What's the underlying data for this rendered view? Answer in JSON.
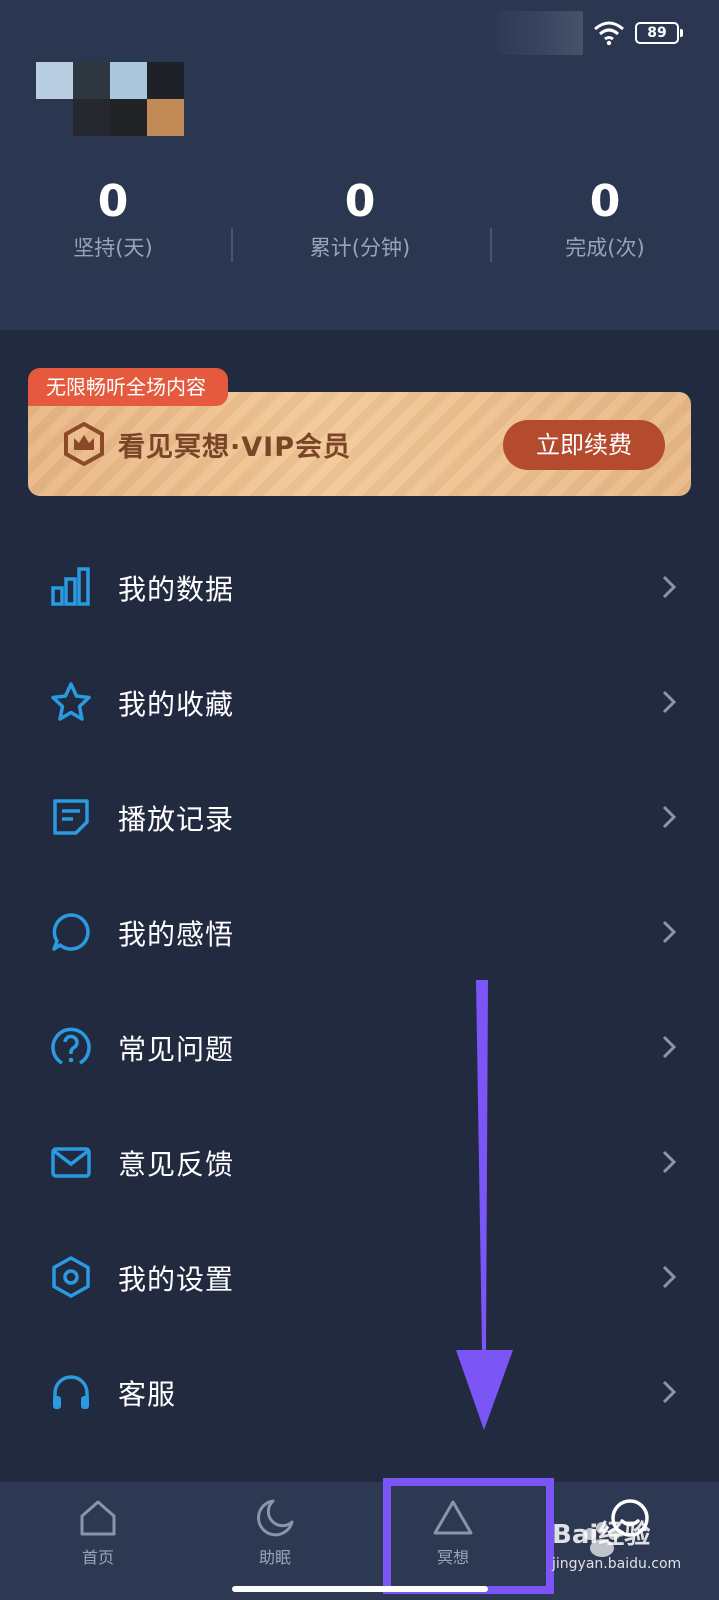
{
  "status": {
    "battery": "89"
  },
  "stats": [
    {
      "value": "0",
      "label": "坚持(天)"
    },
    {
      "value": "0",
      "label": "累计(分钟)"
    },
    {
      "value": "0",
      "label": "完成(次)"
    }
  ],
  "vip": {
    "tag": "无限畅听全场内容",
    "title": "看见冥想·VIP会员",
    "button": "立即续费"
  },
  "menu": [
    {
      "label": "我的数据",
      "icon": "bar-chart-icon"
    },
    {
      "label": "我的收藏",
      "icon": "star-icon"
    },
    {
      "label": "播放记录",
      "icon": "note-icon"
    },
    {
      "label": "我的感悟",
      "icon": "chat-bubble-icon"
    },
    {
      "label": "常见问题",
      "icon": "question-icon"
    },
    {
      "label": "意见反馈",
      "icon": "mail-icon"
    },
    {
      "label": "我的设置",
      "icon": "settings-hexagon-icon"
    },
    {
      "label": "客服",
      "icon": "headphones-icon"
    }
  ],
  "tabs": [
    {
      "label": "首页",
      "icon": "home-icon"
    },
    {
      "label": "助眠",
      "icon": "moon-icon"
    },
    {
      "label": "冥想",
      "icon": "triangle-icon"
    },
    {
      "label": "",
      "icon": "smile-icon"
    }
  ],
  "watermark": {
    "brand": "Bai经验",
    "url": "jingyan.baidu.com"
  },
  "colors": {
    "accent": "#2a9be0",
    "highlight": "#7b55f5",
    "vip_button": "#b44a2e"
  }
}
